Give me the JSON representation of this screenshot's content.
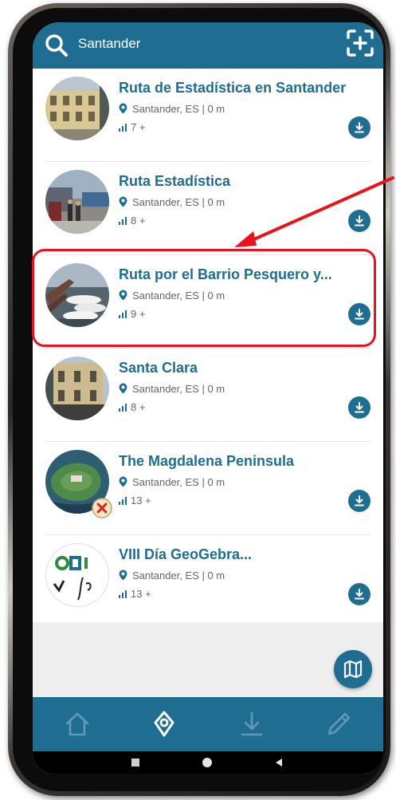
{
  "header": {
    "search_text": "Santander"
  },
  "routes": [
    {
      "title": "Ruta de Estadística en Santander",
      "location": "Santander, ES | 0 m",
      "stat": "7 +"
    },
    {
      "title": "Ruta Estadística",
      "location": "Santander, ES | 0 m",
      "stat": "8 +"
    },
    {
      "title": "Ruta por el Barrio Pesquero y...",
      "location": "Santander, ES | 0 m",
      "stat": "9 +"
    },
    {
      "title": "Santa Clara",
      "location": "Santander, ES | 0 m",
      "stat": "8 +"
    },
    {
      "title": "The Magdalena Peninsula",
      "location": "Santander, ES | 0 m",
      "stat": "13 +"
    },
    {
      "title": "VIII Día GeoGebra...",
      "location": "Santander, ES | 0 m",
      "stat": "13 +"
    }
  ],
  "icons": {
    "search": "search-icon",
    "scan": "scan-add-icon",
    "location": "map-pin-icon",
    "stat": "signal-bars-icon",
    "download": "download-icon",
    "map": "map-icon",
    "nav": [
      "home-icon",
      "location-icon",
      "download-icon",
      "pencil-icon"
    ]
  },
  "colors": {
    "primary": "#1f6e92",
    "highlight": "#e8131c",
    "list_bg": "#ffffff",
    "empty_bg": "#eeeeee"
  }
}
